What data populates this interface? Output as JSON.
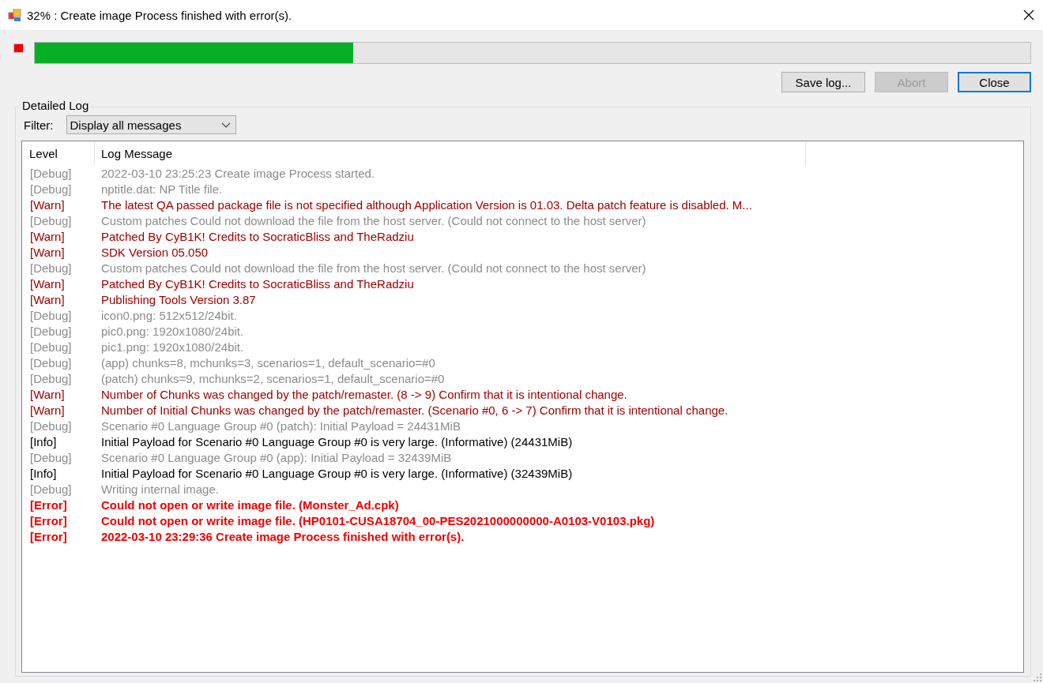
{
  "window": {
    "title": "32% : Create image Process finished with error(s)."
  },
  "progress": {
    "failed": true,
    "level": 0.32
  },
  "buttons": [
    {
      "label": "Save log...",
      "disabled": false,
      "default": false
    },
    {
      "label": "Abort",
      "disabled": true,
      "default": false
    },
    {
      "label": "Close",
      "disabled": false,
      "default": true
    }
  ],
  "log_group": {
    "title": "Detailed Log",
    "filter_label": "Filter:",
    "filter_value": "Display all messages"
  },
  "table": {
    "columns": [
      "Level",
      "Log Message"
    ],
    "rows": [
      {
        "kind": "debug",
        "tag": "[Debug]",
        "message": "2022-03-10 23:25:23 Create image Process started."
      },
      {
        "kind": "debug",
        "tag": "[Debug]",
        "message": "nptitle.dat: NP Title file."
      },
      {
        "kind": "warn",
        "tag": "[Warn]",
        "message": "The latest QA passed package file is not specified although Application Version is 01.03. Delta patch feature is disabled. M..."
      },
      {
        "kind": "debug",
        "tag": "[Debug]",
        "message": "Custom patches Could not download the file from the host server. (Could not connect to the host server)"
      },
      {
        "kind": "warn",
        "tag": "[Warn]",
        "message": "Patched By CyB1K! Credits to SocraticBliss and TheRadziu"
      },
      {
        "kind": "warn",
        "tag": "[Warn]",
        "message": "SDK Version 05.050"
      },
      {
        "kind": "debug",
        "tag": "[Debug]",
        "message": "Custom patches Could not download the file from the host server. (Could not connect to the host server)"
      },
      {
        "kind": "warn",
        "tag": "[Warn]",
        "message": "Patched By CyB1K! Credits to SocraticBliss and TheRadziu"
      },
      {
        "kind": "warn",
        "tag": "[Warn]",
        "message": "Publishing Tools Version 3.87"
      },
      {
        "kind": "debug",
        "tag": "[Debug]",
        "message": "icon0.png: 512x512/24bit."
      },
      {
        "kind": "debug",
        "tag": "[Debug]",
        "message": "pic0.png: 1920x1080/24bit."
      },
      {
        "kind": "debug",
        "tag": "[Debug]",
        "message": "pic1.png: 1920x1080/24bit."
      },
      {
        "kind": "debug",
        "tag": "[Debug]",
        "message": "(app) chunks=8, mchunks=3, scenarios=1, default_scenario=#0"
      },
      {
        "kind": "debug",
        "tag": "[Debug]",
        "message": "(patch) chunks=9, mchunks=2, scenarios=1, default_scenario=#0"
      },
      {
        "kind": "warn",
        "tag": "[Warn]",
        "message": "Number of Chunks was changed by the patch/remaster. (8 -> 9) Confirm that it is intentional change."
      },
      {
        "kind": "warn",
        "tag": "[Warn]",
        "message": "Number of Initial Chunks was changed by the patch/remaster. (Scenario #0, 6 -> 7) Confirm that it is intentional change."
      },
      {
        "kind": "debug",
        "tag": "[Debug]",
        "message": "Scenario #0 Language Group #0 (patch): Initial Payload = 24431MiB"
      },
      {
        "kind": "info",
        "tag": "[Info]",
        "message": "Initial Payload for Scenario #0 Language Group #0 is very large. (Informative) (24431MiB)"
      },
      {
        "kind": "debug",
        "tag": "[Debug]",
        "message": "Scenario #0 Language Group #0 (app): Initial Payload = 32439MiB"
      },
      {
        "kind": "info",
        "tag": "[Info]",
        "message": "Initial Payload for Scenario #0 Language Group #0 is very large. (Informative) (32439MiB)"
      },
      {
        "kind": "debug",
        "tag": "[Debug]",
        "message": "Writing internal image."
      },
      {
        "kind": "error",
        "tag": "[Error]",
        "message": "Could not open or write image file. (Monster_Ad.cpk)"
      },
      {
        "kind": "error",
        "tag": "[Error]",
        "message": "Could not open or write image file. (HP0101-CUSA18704_00-PES2021000000000-A0103-V0103.pkg)"
      },
      {
        "kind": "error",
        "tag": "[Error]",
        "message": "2022-03-10 23:29:36 Create image Process finished with error(s)."
      }
    ]
  }
}
